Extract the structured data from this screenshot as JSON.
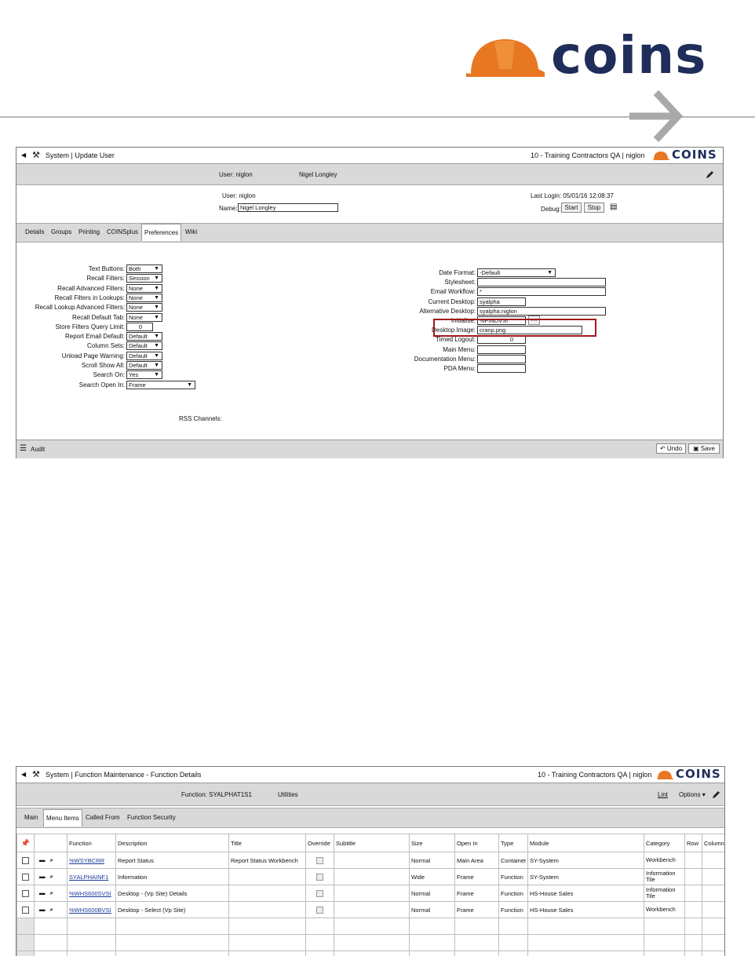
{
  "header": {
    "logo_text": "coins"
  },
  "colors": {
    "accent": "#e87722",
    "brand": "#1f2d5a",
    "highlight_border": "#a01a1a"
  },
  "win1": {
    "title": "System | Update User",
    "right_title": "10 - Training Contractors QA | niglon",
    "logo": "COINS",
    "subheader": {
      "user": "User: niglon",
      "name": "Nigel Longley"
    },
    "info": {
      "user_label": "User: niglon",
      "name_label": "Name:",
      "name_value": "Nigel Longley",
      "last_login": "Last Login: 05/01/16 12:08:37",
      "debug_label": "Debug:",
      "start_label": "Start",
      "stop_label": "Stop"
    },
    "tabs": [
      "Details",
      "Groups",
      "Printing",
      "COINSplus",
      "Preferences",
      "Wiki"
    ],
    "left_fields": [
      {
        "label": "Text Buttons:",
        "value": "Both"
      },
      {
        "label": "Recall Filters:",
        "value": "Session"
      },
      {
        "label": "Recall Advanced Filters:",
        "value": "None"
      },
      {
        "label": "Recall Filters in Lookups:",
        "value": "None"
      },
      {
        "label": "Recall Lookup Advanced Filters:",
        "value": "None"
      },
      {
        "label": "Recall Default Tab:",
        "value": "None"
      },
      {
        "label": "Store Filters Query Limit:",
        "value": "0"
      },
      {
        "label": "Report Email Default:",
        "value": "Default"
      },
      {
        "label": "Column Sets:",
        "value": "Default"
      },
      {
        "label": "Unload Page Warning:",
        "value": "Default"
      },
      {
        "label": "Scroll Show All:",
        "value": "Default"
      },
      {
        "label": "Search On:",
        "value": "Yes"
      },
      {
        "label": "Search Open In:",
        "value": "Frame"
      }
    ],
    "rss_label": "RSS Channels:",
    "right_fields": [
      {
        "label": "Date Format:",
        "value": "-Default"
      },
      {
        "label": "Stylesheet:",
        "value": ""
      },
      {
        "label": "Email Workflow:",
        "value": "*"
      },
      {
        "label": "Current Desktop:",
        "value": "syalpha"
      },
      {
        "label": "Alternative Desktop:",
        "value": "syalpha.niglon"
      },
      {
        "label": "Initialise:",
        "value": "%FINDVSI"
      },
      {
        "label": "Desktop Image:",
        "value": "cranp.png"
      },
      {
        "label": "Timed Logout:",
        "value": "0"
      },
      {
        "label": "Main Menu:",
        "value": ""
      },
      {
        "label": "Documentation Menu:",
        "value": ""
      },
      {
        "label": "PDA Menu:",
        "value": ""
      }
    ],
    "lookup_btn": "•••",
    "footer": {
      "audit": "Audit",
      "undo": "Undo",
      "save": "Save"
    }
  },
  "win2": {
    "title": "System | Function Maintenance - Function Details",
    "right_title": "10 - Training Contractors QA | niglon",
    "logo": "COINS",
    "subheader": {
      "function": "Function: SYALPHAT1S1",
      "utilities": "Utilities",
      "lint": "Lint",
      "options": "Options ▾"
    },
    "tabs": [
      "Main",
      "Menu Items",
      "Called From",
      "Function Security"
    ],
    "columns": [
      "",
      "",
      "Function",
      "Description",
      "Title",
      "Override",
      "Subtitle",
      "Size",
      "Open In",
      "Type",
      "Module",
      "Category",
      "Row",
      "Column"
    ],
    "rows": [
      {
        "function": "%WSYBCRR",
        "description": "Report Status",
        "title": "Report Status Workbench",
        "size": "Normal",
        "open_in": "Main Area",
        "type": "Container",
        "module": "SY-System",
        "category": "Workbench"
      },
      {
        "function": "SYALPHAINF1",
        "description": "Information",
        "title": "",
        "size": "Wide",
        "open_in": "Frame",
        "type": "Function",
        "module": "SY-System",
        "category": "Information Tile"
      },
      {
        "function": "%WHS600SVSI",
        "description": "Desktop - (Vp Site) Details",
        "title": "",
        "size": "Normal",
        "open_in": "Frame",
        "type": "Function",
        "module": "HS-House Sales",
        "category": "Information Tile"
      },
      {
        "function": "%WHS600BVSI",
        "description": "Desktop - Select (Vp Site)",
        "title": "",
        "size": "Normal",
        "open_in": "Frame",
        "type": "Function",
        "module": "HS-House Sales",
        "category": "Workbench"
      }
    ]
  }
}
